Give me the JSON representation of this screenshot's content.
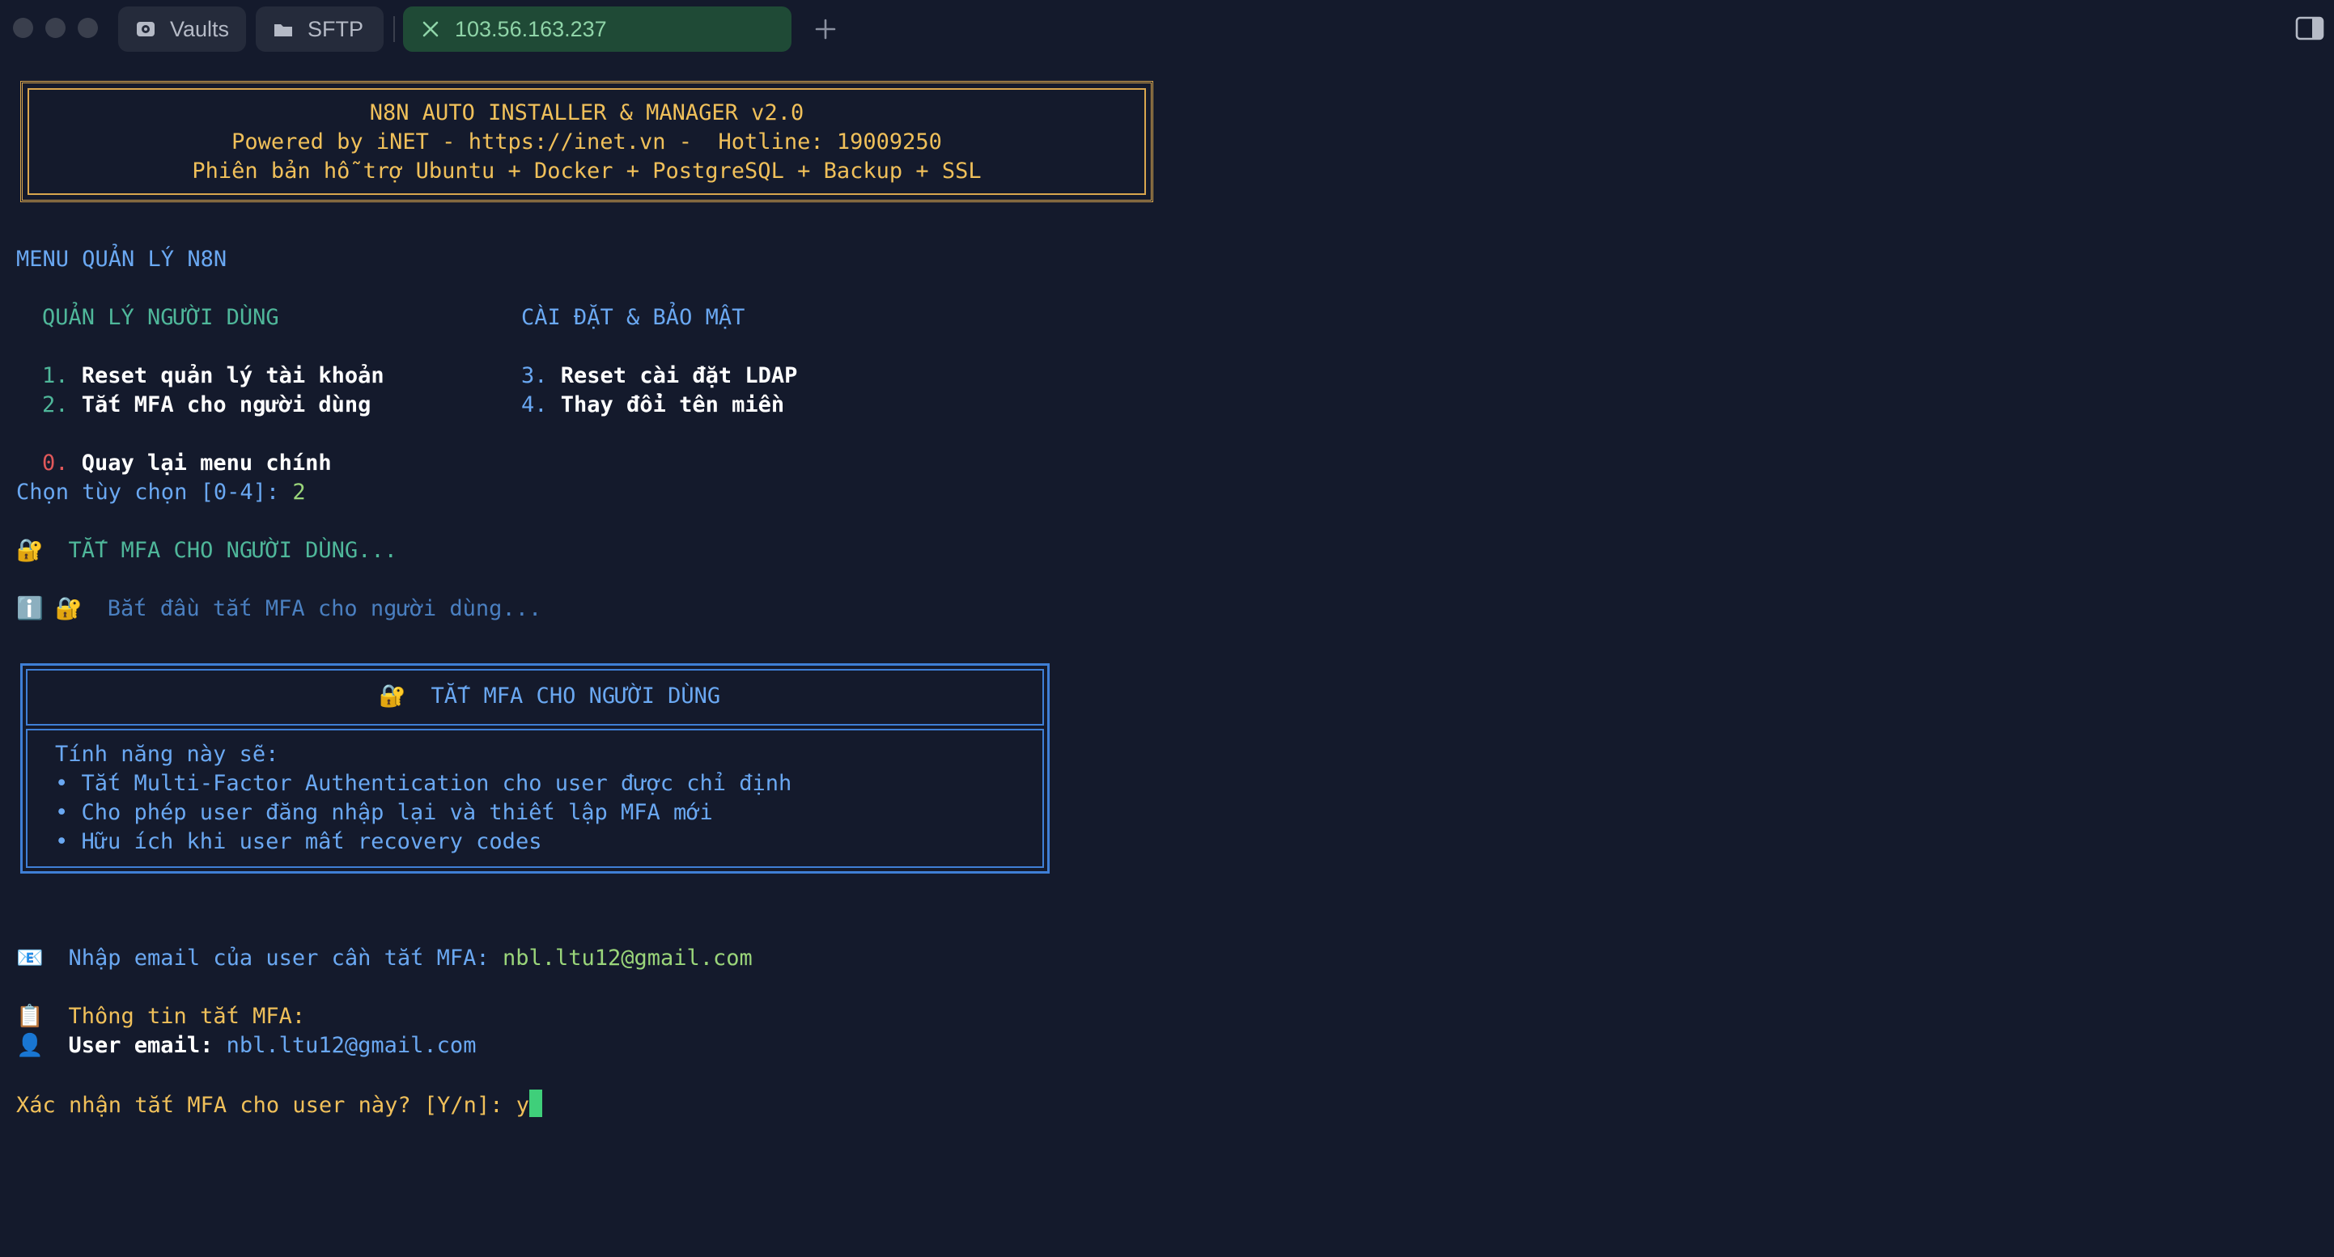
{
  "titlebar": {
    "tabs": [
      {
        "label": "Vaults",
        "icon": "vault-icon"
      },
      {
        "label": "SFTP",
        "icon": "folder-icon"
      },
      {
        "label": "103.56.163.237",
        "icon": "close-icon",
        "active": true
      }
    ],
    "new_tab_icon": "plus-icon",
    "panel_icon": "sidebar-toggle-icon"
  },
  "banner": {
    "line1": "N8N AUTO INSTALLER & MANAGER v2.0",
    "line2": "Powered by iNET - https://inet.vn -  Hotline: 19009250",
    "line3": "Phiên bản hỗ trợ Ubuntu + Docker + PostgreSQL + Backup + SSL"
  },
  "menu": {
    "title": "MENU QUẢN LÝ N8N",
    "col1_header": "QUẢN LÝ NGƯỜI DÙNG",
    "col2_header": "CÀI ĐẶT & BẢO MẬT",
    "items": [
      {
        "num": "1.",
        "label": "Reset quản lý tài khoản"
      },
      {
        "num": "2.",
        "label": "Tắt MFA cho người dùng"
      },
      {
        "num": "3.",
        "label": "Reset cài đặt LDAP"
      },
      {
        "num": "4.",
        "label": "Thay đổi tên miền"
      }
    ],
    "back_num": "0.",
    "back_label": "Quay lại menu chính",
    "prompt": "Chọn tùy chọn [0-4]: ",
    "choice": "2"
  },
  "status": {
    "lock_icon": "🔐",
    "info_icon": "ℹ️",
    "heading": "TẮT MFA CHO NGƯỜI DÙNG...",
    "starting": "Bắt đầu tắt MFA cho người dùng..."
  },
  "mfa_box": {
    "title": "TẮT MFA CHO NGƯỜI DÙNG",
    "intro": "Tính năng này sẽ:",
    "bullets": [
      "• Tắt Multi-Factor Authentication cho user được chỉ định",
      "• Cho phép user đăng nhập lại và thiết lập MFA mới",
      "• Hữu ích khi user mất recovery codes"
    ]
  },
  "email_prompt": {
    "icon": "📧",
    "label": "Nhập email của user cần tắt MFA: ",
    "value": "nbl.ltu12@gmail.com"
  },
  "info": {
    "icon": "📋",
    "heading": "Thông tin tắt MFA:",
    "user_icon": "👤",
    "user_label": "User email:",
    "user_value": "nbl.ltu12@gmail.com"
  },
  "confirm": {
    "prompt": "Xác nhận tắt MFA cho user này? [Y/n]: ",
    "input": "y"
  },
  "colors": {
    "background": "#141a2c",
    "accent_blue": "#6aa8f2",
    "banner_gold": "#f0c05a",
    "active_tab": "#1f4a36"
  }
}
